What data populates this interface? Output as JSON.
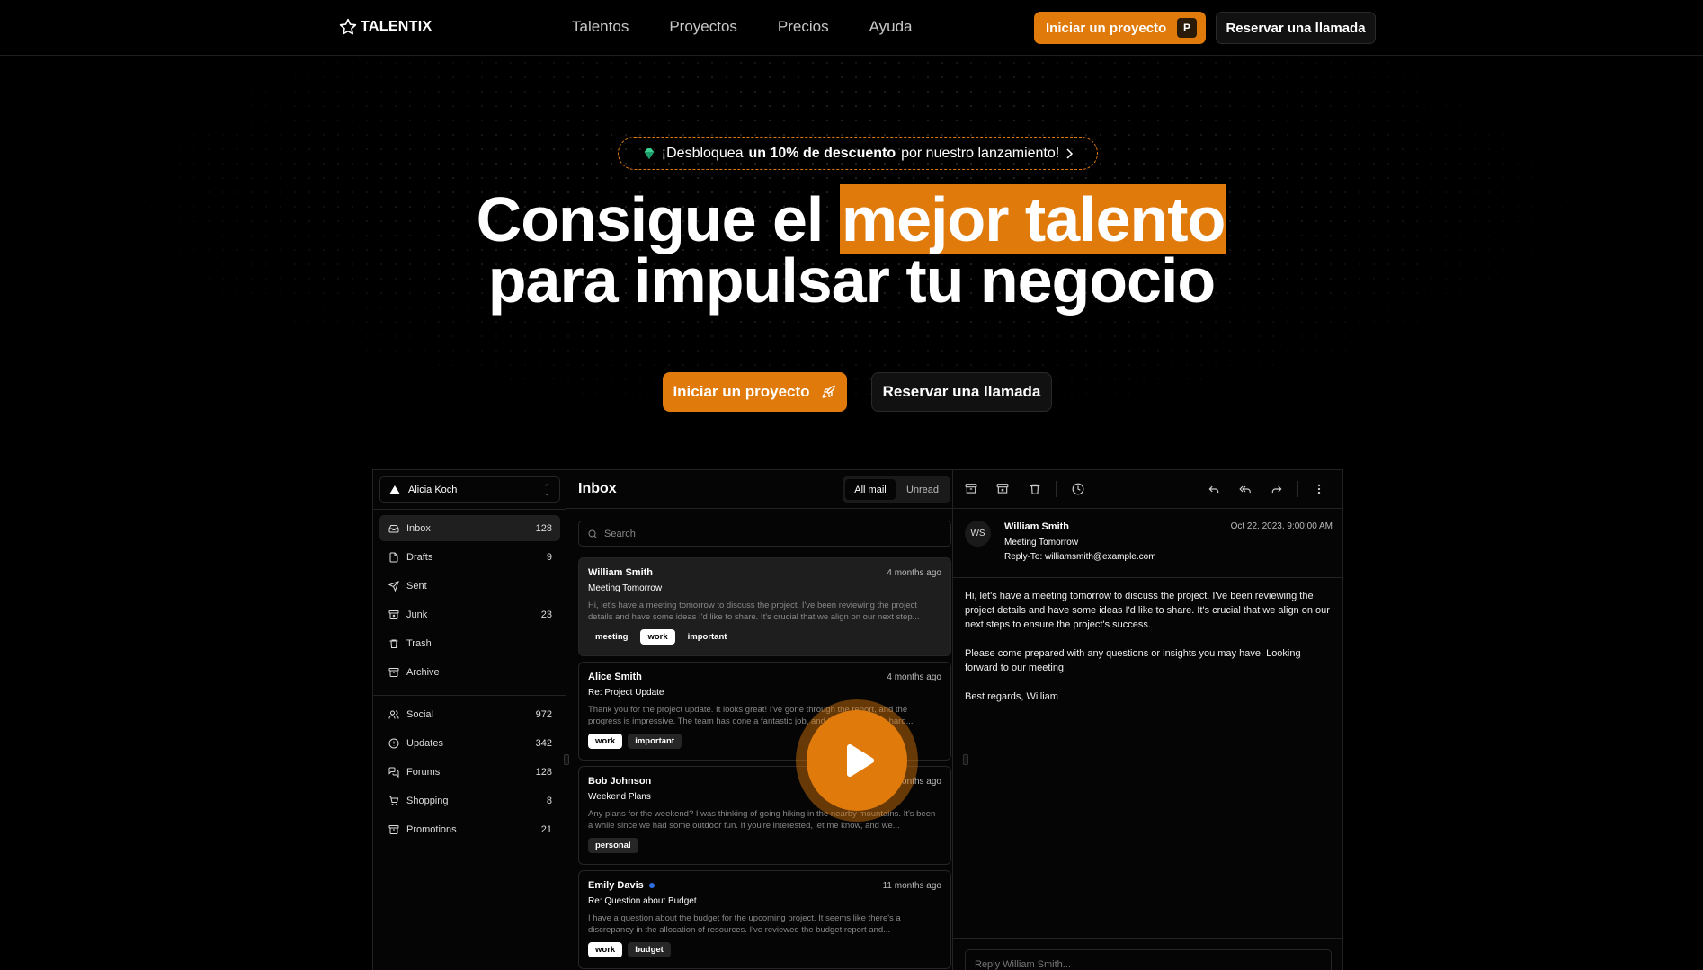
{
  "nav": {
    "logo": "TALENTIX",
    "links": [
      "Talentos",
      "Proyectos",
      "Precios",
      "Ayuda"
    ],
    "cta_primary": "Iniciar un proyecto",
    "cta_kbd": "P",
    "cta_secondary": "Reservar una llamada"
  },
  "hero": {
    "promo_pre": "¡Desbloquea",
    "promo_bold": "un 10% de descuento",
    "promo_post": "por nuestro lanzamiento!",
    "title_a": "Consigue el",
    "title_highlight": "mejor talento",
    "title_b": "para impulsar tu negocio",
    "cta_primary": "Iniciar un proyecto",
    "cta_secondary": "Reservar una llamada",
    "accent": "#e07a0b"
  },
  "app": {
    "account": "Alicia Koch",
    "folders": [
      {
        "label": "Inbox",
        "count": "128",
        "icon": "inbox-icon"
      },
      {
        "label": "Drafts",
        "count": "9",
        "icon": "file-icon"
      },
      {
        "label": "Sent",
        "count": "",
        "icon": "send-icon"
      },
      {
        "label": "Junk",
        "count": "23",
        "icon": "archive-x-icon"
      },
      {
        "label": "Trash",
        "count": "",
        "icon": "trash-icon"
      },
      {
        "label": "Archive",
        "count": "",
        "icon": "archive-icon"
      }
    ],
    "categories": [
      {
        "label": "Social",
        "count": "972",
        "icon": "users-icon"
      },
      {
        "label": "Updates",
        "count": "342",
        "icon": "alert-circle-icon"
      },
      {
        "label": "Forums",
        "count": "128",
        "icon": "messages-icon"
      },
      {
        "label": "Shopping",
        "count": "8",
        "icon": "cart-icon"
      },
      {
        "label": "Promotions",
        "count": "21",
        "icon": "archive-icon"
      }
    ],
    "list_title": "Inbox",
    "filter_all": "All mail",
    "filter_unread": "Unread",
    "search_placeholder": "Search",
    "mails": [
      {
        "from": "William Smith",
        "time": "4 months ago",
        "subject": "Meeting Tomorrow",
        "snippet": "Hi, let's have a meeting tomorrow to discuss the project. I've been reviewing the project details and have some ideas I'd like to share. It's crucial that we align on our next step...",
        "tags": [
          "meeting",
          "work",
          "important"
        ],
        "unread": false
      },
      {
        "from": "Alice Smith",
        "time": "4 months ago",
        "subject": "Re: Project Update",
        "snippet": "Thank you for the project update. It looks great! I've gone through the report, and the progress is impressive. The team has done a fantastic job, and I appreciate the hard...",
        "tags": [
          "work",
          "important"
        ],
        "unread": false
      },
      {
        "from": "Bob Johnson",
        "time": "4 months ago",
        "subject": "Weekend Plans",
        "snippet": "Any plans for the weekend? I was thinking of going hiking in the nearby mountains. It's been a while since we had some outdoor fun. If you're interested, let me know, and we...",
        "tags": [
          "personal"
        ],
        "unread": false
      },
      {
        "from": "Emily Davis",
        "time": "11 months ago",
        "subject": "Re: Question about Budget",
        "snippet": "I have a question about the budget for the upcoming project. It seems like there's a discrepancy in the allocation of resources. I've reviewed the budget report and...",
        "tags": [
          "work",
          "budget"
        ],
        "unread": true
      }
    ],
    "reader": {
      "initials": "WS",
      "name": "William Smith",
      "subject": "Meeting Tomorrow",
      "reply_to": "Reply-To: williamsmith@example.com",
      "date": "Oct 22, 2023, 9:00:00 AM",
      "body": [
        "Hi, let's have a meeting tomorrow to discuss the project. I've been reviewing the project details and have some ideas I'd like to share. It's crucial that we align on our next steps to ensure the project's success.",
        "Please come prepared with any questions or insights you may have. Looking forward to our meeting!",
        "Best regards, William"
      ],
      "reply_placeholder": "Reply William Smith..."
    }
  }
}
